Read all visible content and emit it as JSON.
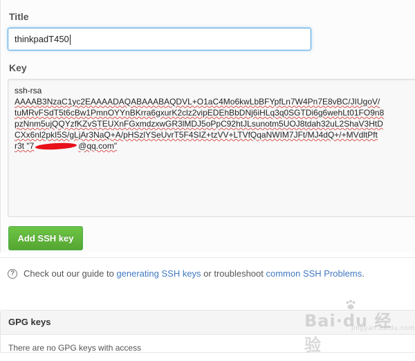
{
  "form": {
    "title_label": "Title",
    "title_value": "thinkpadT450",
    "key_label": "Key",
    "key_lines": [
      "ssh-rsa",
      "AAAAB3NzaC1yc2EAAAADAQABAAABAQDVL+O1aC4Mo6kwLbBFYpfLn7W4Pn7E8vBC/JIUgoV/",
      "tuMRvFSdT5t6cBw1PmnOYYnBKrra6gxurK2clz2vipEDEhBbDNj6iHLq3q0SGTDi6g6wehLt01FO9n8",
      "pzNnm5ujQQYzfKZvSTEUXnFGxmdzxwGR3lMDJ5oPpC92htJLsunotm5UOJ8tdah32uL2ShaV3HtD",
      "CXx6nl2pkI5S/gLjAr3NaQ+A/pHSzlYSeUvrT5F4SIZ+tzVV+LTVfQqaNWIM7JFt/MJ4dQ+/+MVdltPft"
    ],
    "key_last_prefix": "r3t \"7",
    "key_last_suffix": "@qq.com\"",
    "add_button": "Add SSH key"
  },
  "help": {
    "icon": "question-circle-icon",
    "prefix": "Check out our guide to ",
    "link1": "generating SSH keys",
    "middle": " or troubleshoot ",
    "link2": "common SSH Problems",
    "suffix": "."
  },
  "gpg": {
    "header": "GPG keys",
    "body": "There are no GPG keys with access"
  },
  "watermark": {
    "brand": "Bai·du 经验",
    "sub": "jingyan.baidu.com"
  },
  "colors": {
    "accent": "#51a7e8",
    "button_green": "#6cc644",
    "link": "#4078c0",
    "redaction": "#e8101a"
  }
}
